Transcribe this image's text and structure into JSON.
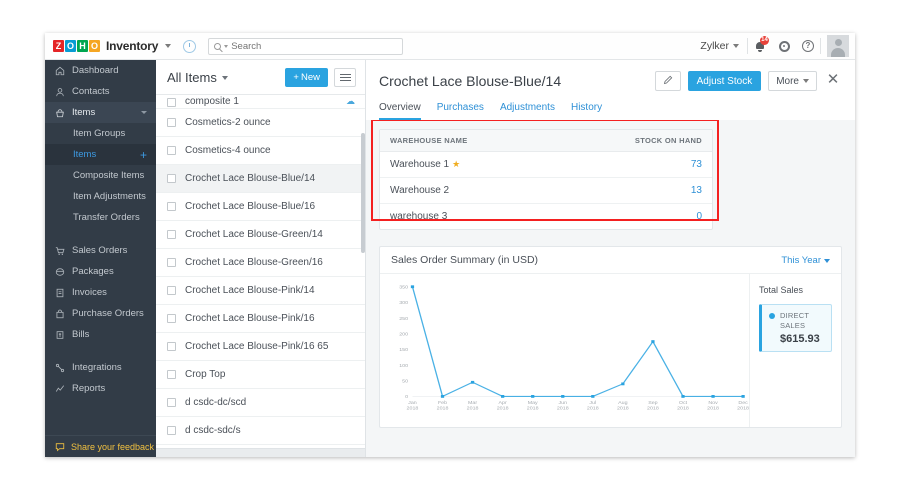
{
  "topbar": {
    "brand": "Inventory",
    "logo_letters": [
      "Z",
      "O",
      "H",
      "O"
    ],
    "search_placeholder": "Search",
    "search_value": "",
    "org_name": "Zylker",
    "notification_count": "14",
    "help_glyph": "?",
    "icons": {
      "clock": "recent-items-icon",
      "search": "search-icon",
      "bell": "notifications-icon",
      "gear": "settings-icon",
      "help": "help-icon",
      "avatar": "user-avatar"
    }
  },
  "sidebar": {
    "items": [
      {
        "label": "Dashboard",
        "icon": "home-icon",
        "type": "item"
      },
      {
        "label": "Contacts",
        "icon": "contacts-icon",
        "type": "item"
      },
      {
        "label": "Items",
        "icon": "items-icon",
        "type": "expanded"
      },
      {
        "label": "Item Groups",
        "type": "sub"
      },
      {
        "label": "Items",
        "type": "sub-active",
        "action": "+"
      },
      {
        "label": "Composite Items",
        "type": "sub"
      },
      {
        "label": "Item Adjustments",
        "type": "sub"
      },
      {
        "label": "Transfer Orders",
        "type": "sub"
      },
      {
        "label": "Sales Orders",
        "icon": "cart-icon",
        "type": "item"
      },
      {
        "label": "Packages",
        "icon": "package-icon",
        "type": "item"
      },
      {
        "label": "Invoices",
        "icon": "invoice-icon",
        "type": "item"
      },
      {
        "label": "Purchase Orders",
        "icon": "bag-icon",
        "type": "item"
      },
      {
        "label": "Bills",
        "icon": "bill-icon",
        "type": "item"
      },
      {
        "label": "Integrations",
        "icon": "integrations-icon",
        "type": "item"
      },
      {
        "label": "Reports",
        "icon": "reports-icon",
        "type": "item"
      }
    ],
    "feedback_label": "Share your feedback"
  },
  "list_pane": {
    "title": "All Items",
    "new_button": "New",
    "new_button_prefix": "+",
    "rows": [
      {
        "label": "composite 1",
        "partial": true,
        "cloud": true
      },
      {
        "label": "Cosmetics-2 ounce"
      },
      {
        "label": "Cosmetics-4 ounce"
      },
      {
        "label": "Crochet Lace Blouse-Blue/14",
        "selected": true
      },
      {
        "label": "Crochet Lace Blouse-Blue/16"
      },
      {
        "label": "Crochet Lace Blouse-Green/14"
      },
      {
        "label": "Crochet Lace Blouse-Green/16"
      },
      {
        "label": "Crochet Lace Blouse-Pink/14"
      },
      {
        "label": "Crochet Lace Blouse-Pink/16"
      },
      {
        "label": "Crochet Lace Blouse-Pink/16 65"
      },
      {
        "label": "Crop Top"
      },
      {
        "label": "d csdc-dc/scd"
      },
      {
        "label": "d csdc-sdc/s"
      }
    ]
  },
  "detail": {
    "title": "Crochet Lace Blouse-Blue/14",
    "edit_icon": "pencil-icon",
    "adjust_stock_label": "Adjust Stock",
    "more_label": "More",
    "close_icon": "close-icon",
    "tabs": [
      {
        "label": "Overview",
        "active": true
      },
      {
        "label": "Purchases",
        "active": false
      },
      {
        "label": "Adjustments",
        "active": false
      },
      {
        "label": "History",
        "active": false
      }
    ],
    "warehouse_table": {
      "columns": [
        "WAREHOUSE NAME",
        "STOCK ON HAND"
      ],
      "rows": [
        {
          "name": "Warehouse 1",
          "primary": true,
          "star": "★",
          "stock": "73"
        },
        {
          "name": "Warehouse 2",
          "primary": false,
          "stock": "13"
        },
        {
          "name": "warehouse 3",
          "primary": false,
          "stock": "0"
        }
      ]
    },
    "highlight_color": "#f42020"
  },
  "chart_panel": {
    "title": "Sales Order Summary (in USD)",
    "period": "This Year",
    "legend_title": "Total Sales",
    "legend_entries": [
      {
        "name": "DIRECT SALES",
        "value": "$615.93",
        "color": "#2aa3e0"
      }
    ]
  },
  "chart_data": {
    "type": "line",
    "title": "Sales Order Summary (in USD)",
    "xlabel": "",
    "ylabel": "",
    "categories": [
      "Jan 2018",
      "Feb 2018",
      "Mar 2018",
      "Apr 2018",
      "May 2018",
      "Jun 2018",
      "Jul 2018",
      "Aug 2018",
      "Sep 2018",
      "Oct 2018",
      "Nov 2018",
      "Dec 2018"
    ],
    "tick_lines": [
      [
        "Jan",
        "2018"
      ],
      [
        "Feb",
        "2018"
      ],
      [
        "Mar",
        "2018"
      ],
      [
        "Apr",
        "2018"
      ],
      [
        "May",
        "2018"
      ],
      [
        "Jun",
        "2018"
      ],
      [
        "Jul",
        "2018"
      ],
      [
        "Aug",
        "2018"
      ],
      [
        "Sep",
        "2018"
      ],
      [
        "Oct",
        "2018"
      ],
      [
        "Nov",
        "2018"
      ],
      [
        "Dec",
        "2018"
      ]
    ],
    "series": [
      {
        "name": "DIRECT SALES",
        "color": "#2aa3e0",
        "values": [
          350,
          0,
          45,
          0,
          0,
          0,
          0,
          40,
          175,
          0,
          0,
          0
        ]
      }
    ],
    "yticks": [
      0,
      50,
      100,
      150,
      200,
      250,
      300,
      350
    ],
    "ylim": [
      0,
      350
    ],
    "grid": false,
    "legend_position": "right",
    "markers": true
  },
  "accent_colors": {
    "primary": "#2aa3e0",
    "sidebar": "#323c47",
    "sidebar_active": "#2a333d",
    "highlight": "#f42020",
    "star": "#f0ad20",
    "feedback": "#f0c040"
  }
}
